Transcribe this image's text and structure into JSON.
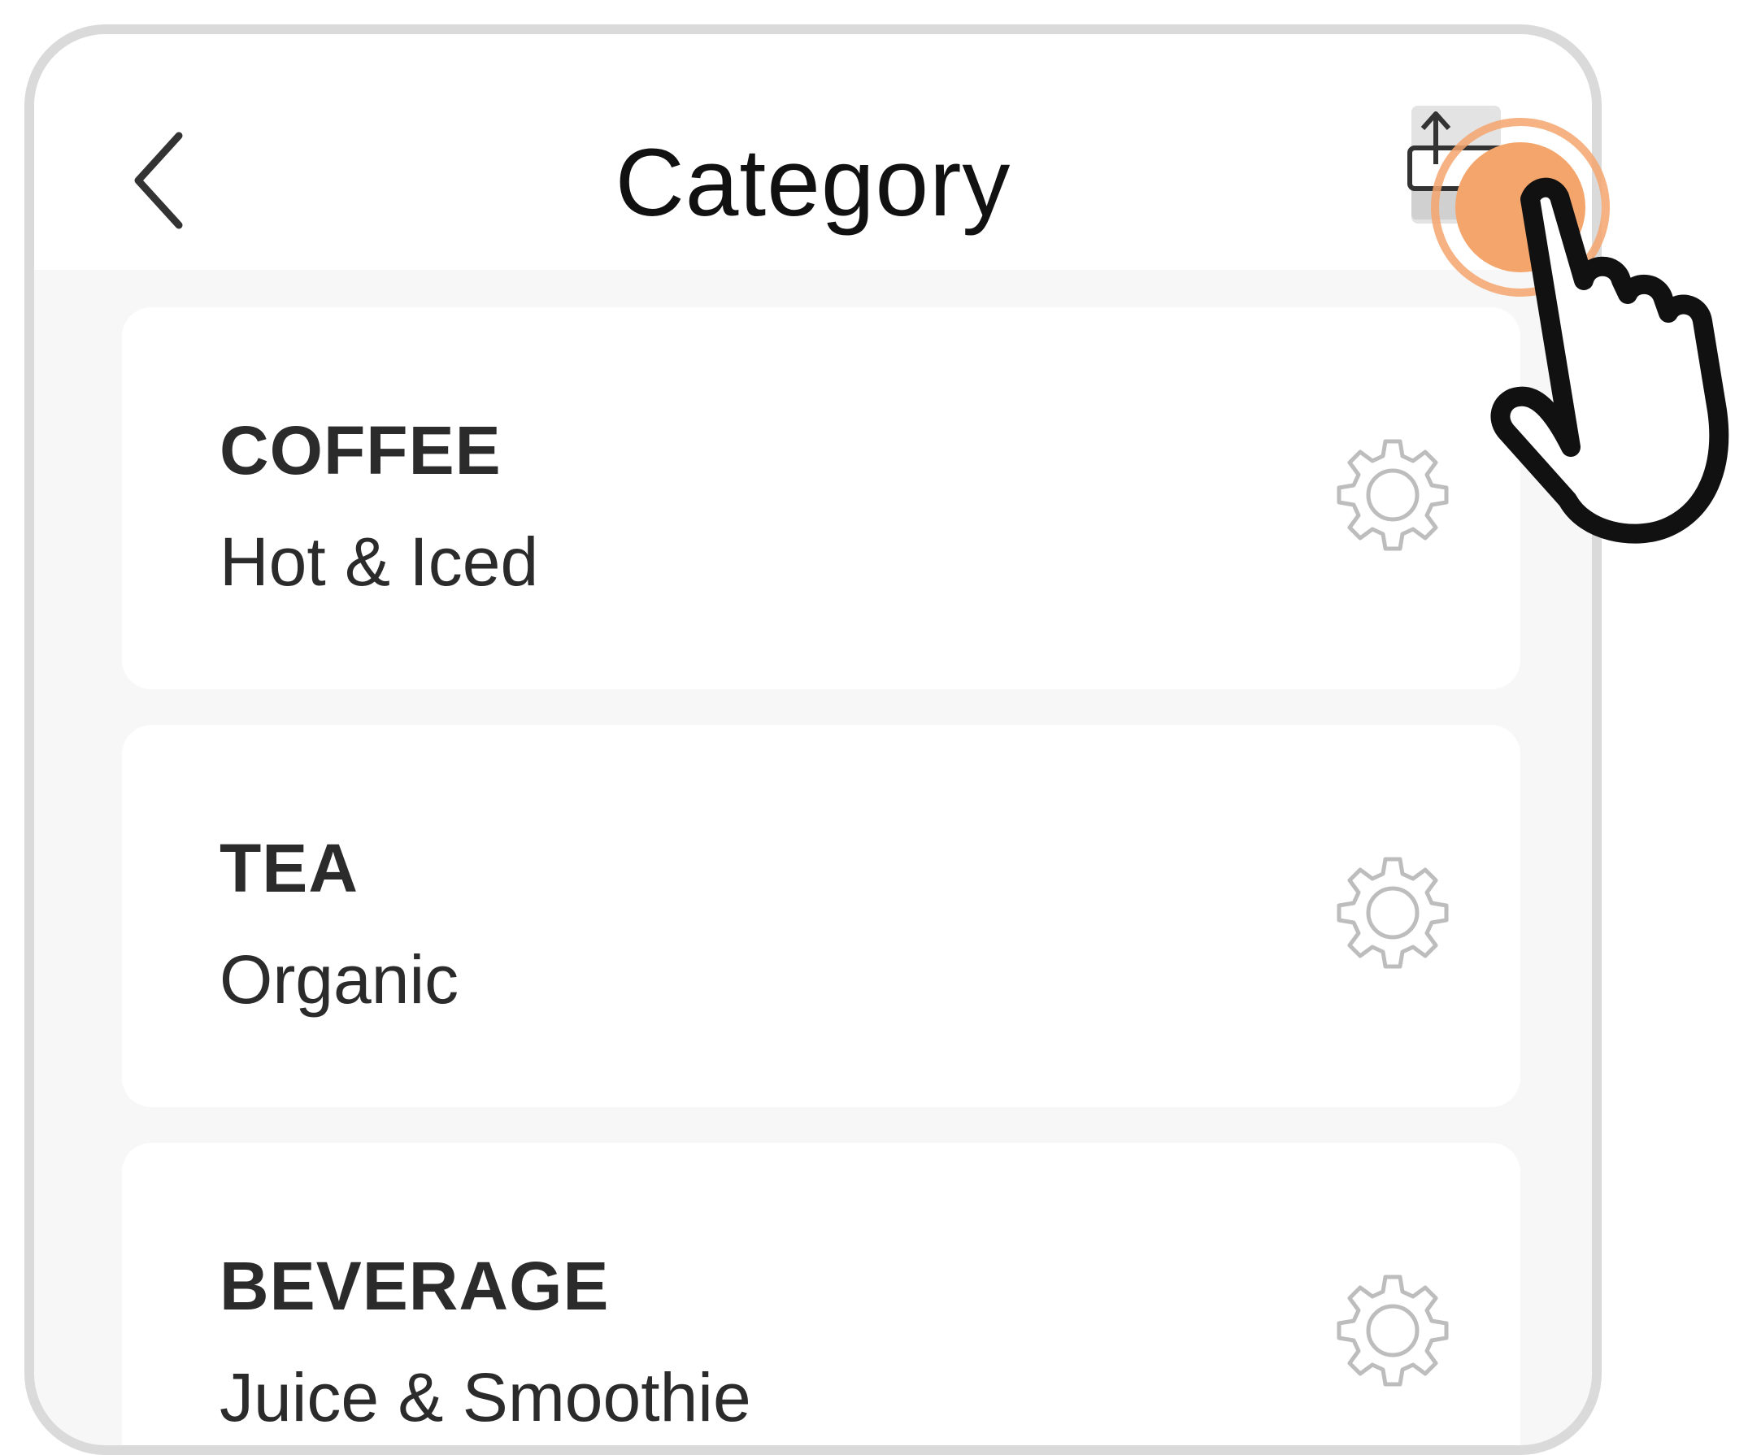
{
  "header": {
    "title": "Category",
    "back_icon": "chevron-left-icon",
    "reorder_icon": "reorder-arrows-icon"
  },
  "categories": [
    {
      "name": "COFFEE",
      "description": "Hot & Iced",
      "settings_icon": "gear-icon"
    },
    {
      "name": "TEA",
      "description": "Organic",
      "settings_icon": "gear-icon"
    },
    {
      "name": "BEVERAGE",
      "description": "Juice & Smoothie",
      "settings_icon": "gear-icon"
    }
  ],
  "overlay": {
    "tap_indicator_icon": "pointing-hand-icon",
    "accent_color": "#f4a56c"
  },
  "colors": {
    "frame": "#dadada",
    "background": "#f7f7f7",
    "card": "#ffffff",
    "text": "#2b2b2b",
    "gear": "#bdbdbd"
  }
}
